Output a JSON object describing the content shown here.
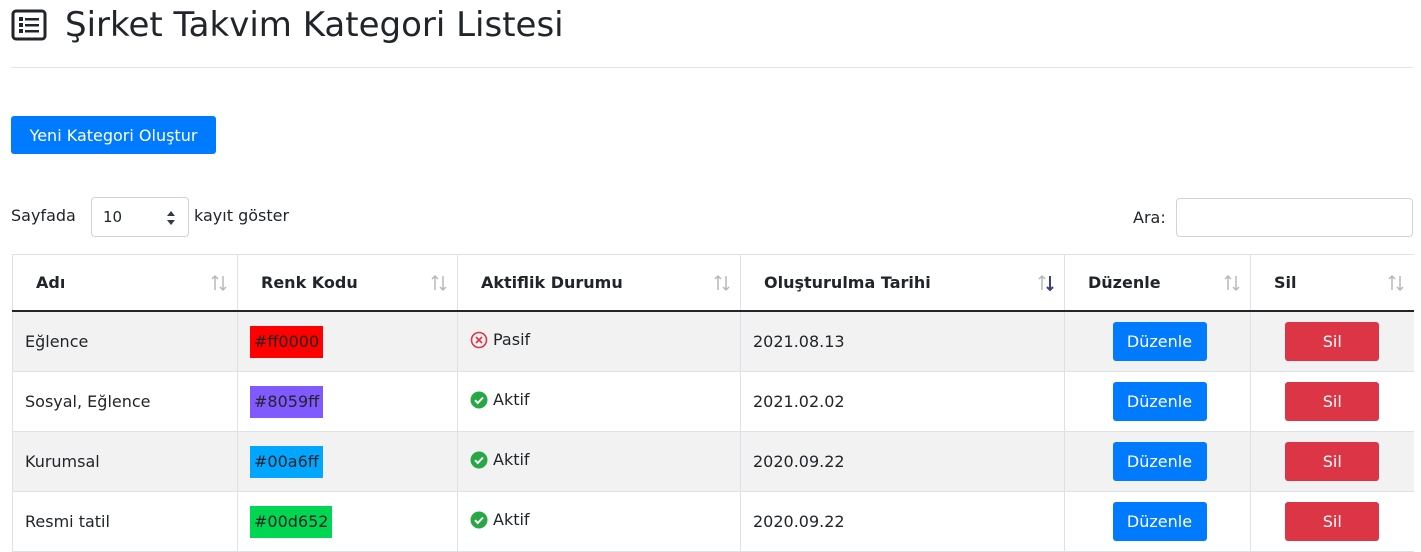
{
  "header": {
    "title": "Şirket Takvim Kategori Listesi",
    "icon": "list-alt-icon"
  },
  "actions": {
    "new_category_label": "Yeni Kategori Oluştur"
  },
  "length_menu": {
    "prefix": "Sayfada",
    "value": "10",
    "suffix": "kayıt göster"
  },
  "search": {
    "label": "Ara:",
    "value": ""
  },
  "table": {
    "columns": [
      "Adı",
      "Renk Kodu",
      "Aktiflik Durumu",
      "Oluşturulma Tarihi",
      "Düzenle",
      "Sil"
    ],
    "sorted_column": "Oluşturulma Tarihi",
    "sorted_direction": "desc",
    "rows": [
      {
        "name": "Eğlence",
        "color": "#ff0000",
        "status": "Pasif",
        "active": false,
        "date": "2021.08.13",
        "edit_label": "Düzenle",
        "delete_label": "Sil"
      },
      {
        "name": "Sosyal, Eğlence",
        "color": "#8059ff",
        "status": "Aktif",
        "active": true,
        "date": "2021.02.02",
        "edit_label": "Düzenle",
        "delete_label": "Sil"
      },
      {
        "name": "Kurumsal",
        "color": "#00a6ff",
        "status": "Aktif",
        "active": true,
        "date": "2020.09.22",
        "edit_label": "Düzenle",
        "delete_label": "Sil"
      },
      {
        "name": "Resmi tatil",
        "color": "#00d652",
        "status": "Aktif",
        "active": true,
        "date": "2020.09.22",
        "edit_label": "Düzenle",
        "delete_label": "Sil"
      }
    ]
  },
  "colors": {
    "primary": "#007bff",
    "danger": "#dc3545",
    "success": "#28a745",
    "error": "#dc3545",
    "stripe": "#f2f2f2"
  }
}
